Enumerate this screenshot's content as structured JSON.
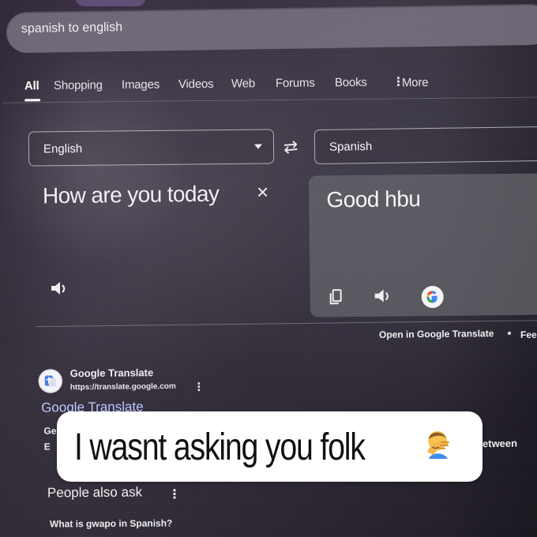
{
  "search": {
    "value": "spanish to english",
    "placeholder": ""
  },
  "tabs": [
    {
      "label": "All"
    },
    {
      "label": "Shopping"
    },
    {
      "label": "Images"
    },
    {
      "label": "Videos"
    },
    {
      "label": "Web"
    },
    {
      "label": "Forums"
    },
    {
      "label": "Books"
    },
    {
      "label": "More"
    }
  ],
  "translator": {
    "source_language": "English",
    "target_language": "Spanish",
    "source_text": "How are you today",
    "translated_text": "Good hbu",
    "open_label": "Open in Google Translate",
    "feedback_label": "Fee"
  },
  "result": {
    "site_name": "Google Translate",
    "url": "https://translate.google.com",
    "title": "Google Translate",
    "snippet_fragment": "Ge E",
    "right_fragment": "between"
  },
  "people_also_ask": {
    "title": "People also ask",
    "question": "What is gwapo in Spanish?"
  },
  "caption": {
    "text": "I wasnt asking you folk"
  },
  "icons": {
    "more": "more-vertical-icon",
    "swap": "swap-icon",
    "dropdown": "chevron-down-icon",
    "clear": "close-icon",
    "speaker": "speaker-icon",
    "copy": "copy-icon",
    "google": "google-icon",
    "translate": "translate-icon",
    "emoji": "facepalm-emoji"
  },
  "colors": {
    "link": "#b9c7ff",
    "panel": "#68696f",
    "caption_bg": "#ffffff"
  }
}
